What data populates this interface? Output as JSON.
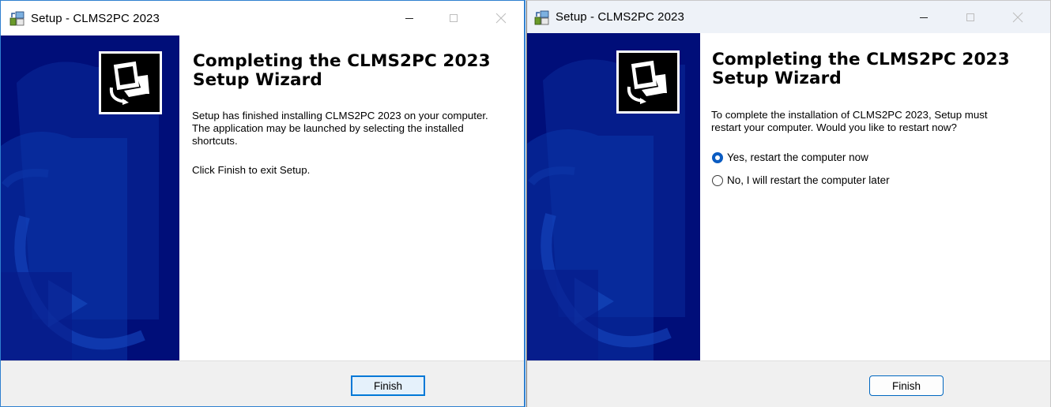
{
  "left_window": {
    "title": "Setup - CLMS2PC 2023",
    "heading_line1": "Completing the CLMS2PC 2023",
    "heading_line2": "Setup Wizard",
    "message_lines": [
      "Setup has finished installing CLMS2PC 2023 on your computer.",
      "The application may be launched by selecting the installed",
      "shortcuts."
    ],
    "exit_note": "Click Finish to exit Setup.",
    "finish_label": "Finish"
  },
  "right_window": {
    "title": "Setup - CLMS2PC 2023",
    "heading_line1": "Completing the CLMS2PC 2023",
    "heading_line2": "Setup Wizard",
    "message_lines": [
      "To complete the installation of CLMS2PC 2023, Setup must",
      "restart your computer. Would you like to restart now?"
    ],
    "options": [
      {
        "label": "Yes, restart the computer now",
        "selected": true
      },
      {
        "label": "No, I will restart the computer later",
        "selected": false
      }
    ],
    "finish_label": "Finish"
  },
  "icons": {
    "app": "setup-app-icon",
    "minimize": "minimize-icon",
    "maximize": "maximize-icon",
    "close": "close-icon",
    "logo": "installer-computer-logo"
  },
  "colors": {
    "sidebar": "#000e79",
    "accent": "#0078d7",
    "radio_selected": "#0b5cc2"
  }
}
